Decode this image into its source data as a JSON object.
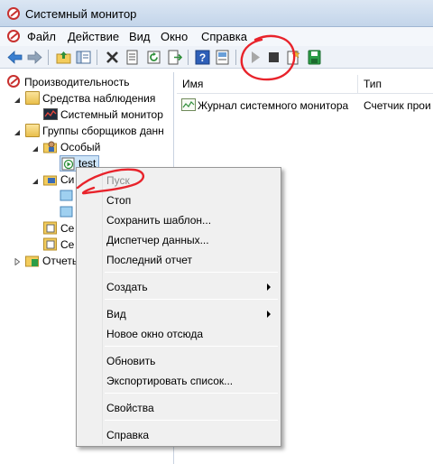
{
  "window": {
    "title": "Системный монитор"
  },
  "menu": {
    "items": [
      "Файл",
      "Действие",
      "Вид",
      "Окно",
      "Справка"
    ]
  },
  "toolbar": {
    "icons": [
      "back-arrow-icon",
      "forward-arrow-icon",
      "up-folder-icon",
      "show-hide-tree-icon",
      "delete-icon",
      "properties-icon",
      "refresh-icon",
      "export-list-icon",
      "help-icon",
      "help-topics-icon",
      "start-icon",
      "stop-icon",
      "new-icon",
      "save-icon"
    ]
  },
  "tree": {
    "root": "Производительность",
    "monitoring_tools": "Средства наблюдения",
    "system_monitor": "Системный монитор",
    "collector_groups": "Группы сборщиков данн",
    "special": "Особый",
    "test": "test",
    "system_partial": "Си",
    "session1_partial": "Се",
    "session2_partial": "Се",
    "reports": "Отчеты"
  },
  "list": {
    "columns": [
      "Имя",
      "Тип"
    ],
    "rows": [
      {
        "name": "Журнал системного монитора",
        "type": "Счетчик прои"
      }
    ]
  },
  "context_menu": {
    "start": "Пуск",
    "stop": "Стоп",
    "save_template": "Сохранить шаблон...",
    "data_manager": "Диспетчер данных...",
    "latest_report": "Последний отчет",
    "create": "Создать",
    "view": "Вид",
    "new_window": "Новое окно отсюда",
    "refresh": "Обновить",
    "export_list": "Экспортировать список...",
    "properties": "Свойства",
    "help": "Справка"
  },
  "colors": {
    "annotation": "#e8232b",
    "selection": "#cde4f7",
    "titlebar": "#c3d5ea"
  }
}
